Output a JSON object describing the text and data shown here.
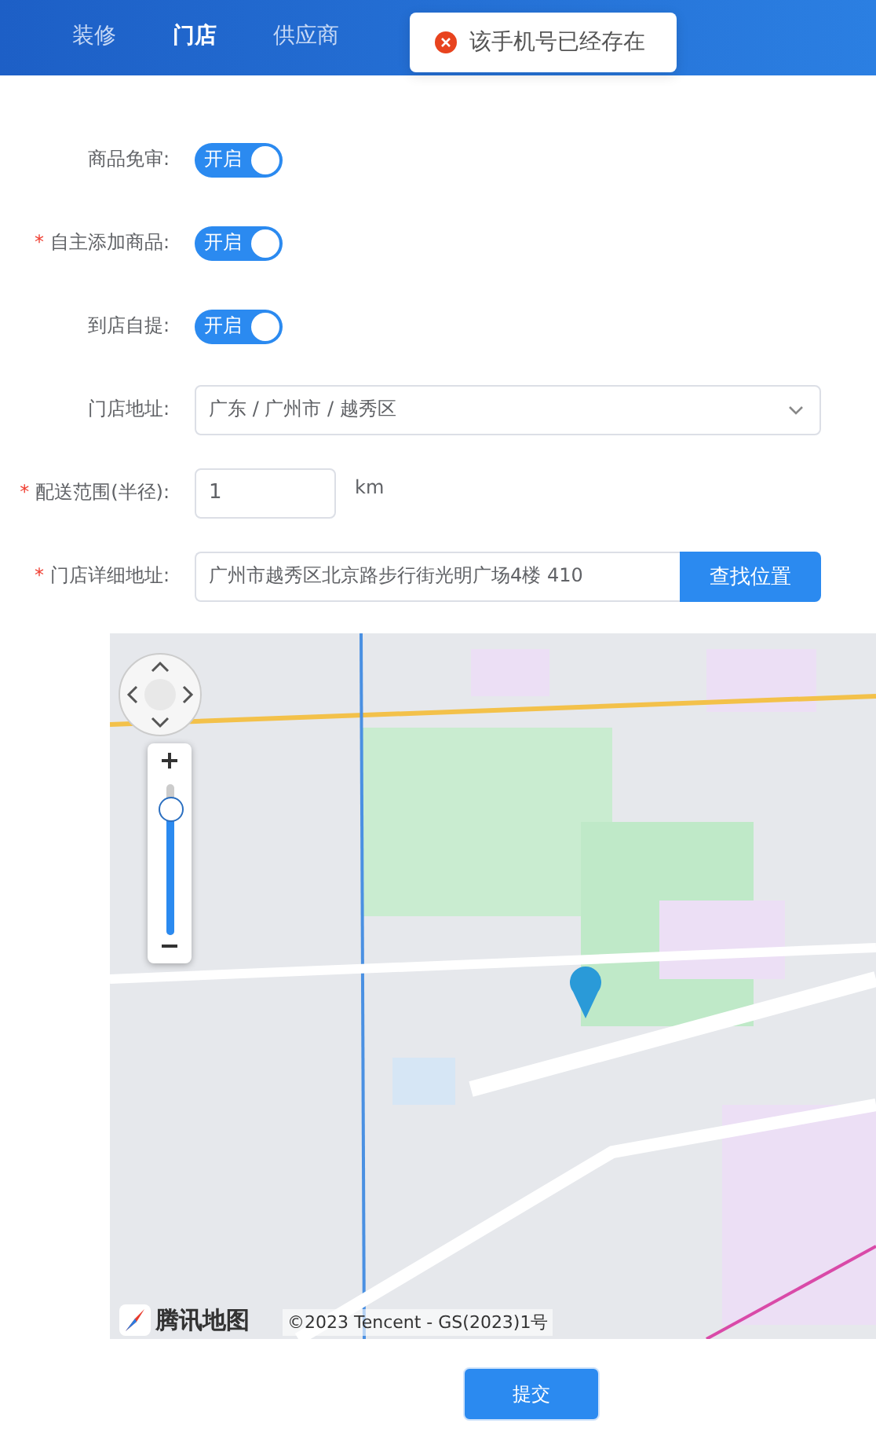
{
  "nav": {
    "tabs": [
      {
        "label": "装修",
        "selected": false
      },
      {
        "label": "门店",
        "selected": true
      },
      {
        "label": "供应商",
        "selected": false
      }
    ]
  },
  "toast": {
    "kind": "error",
    "message": "该手机号已经存在"
  },
  "form": {
    "rows": [
      {
        "kind": "switch",
        "label": "商品免审:",
        "on": true,
        "text": "开启"
      },
      {
        "kind": "switch",
        "label": "自主添加商品:",
        "mark": "*",
        "on": true,
        "text": "开启"
      },
      {
        "kind": "switch",
        "label": "到店自提:",
        "on": true,
        "text": "开启"
      },
      {
        "kind": "select",
        "label": "门店地址:",
        "value": "广东 / 广州市 / 越秀区"
      },
      {
        "kind": "number",
        "label": "配送范围(半径):",
        "mark": "*",
        "value": "1",
        "unit": "km"
      },
      {
        "kind": "search",
        "label": "门店详细地址:",
        "mark": "*",
        "value": "广州市越秀区北京路步行街光明广场4楼 410",
        "button": "查找位置"
      }
    ]
  },
  "map": {
    "kind": "picture",
    "zoom": {
      "level": 0.82
    },
    "logo": "腾讯地图",
    "copyright": "©2023 Tencent - GS(2023)1号"
  },
  "submit": "提交"
}
